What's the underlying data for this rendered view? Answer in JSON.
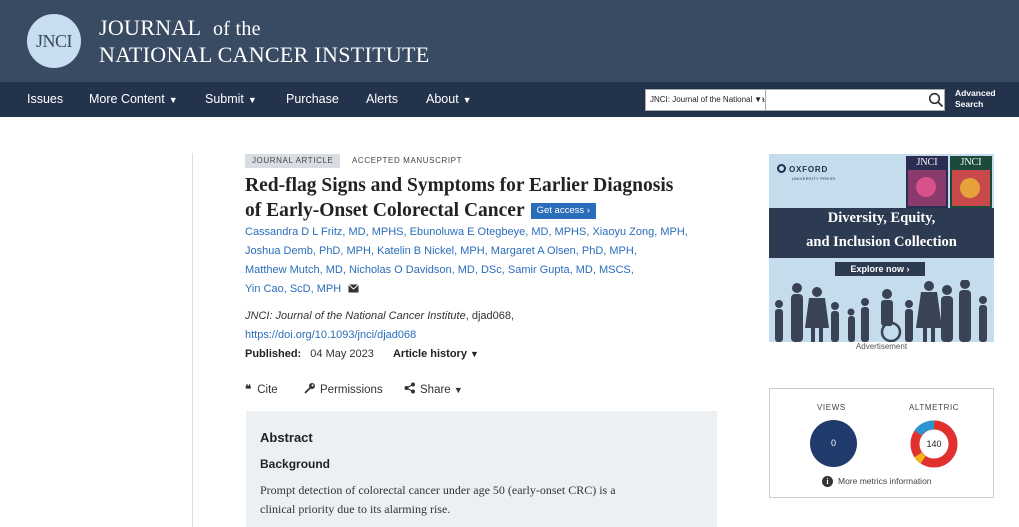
{
  "header": {
    "logo_text": "JNCI",
    "title_line1_a": "JOURNAL",
    "title_line1_b": "of the",
    "title_line2": "NATIONAL CANCER INSTITUTE"
  },
  "nav": {
    "items": [
      {
        "label": "Issues",
        "dropdown": false
      },
      {
        "label": "More Content",
        "dropdown": true
      },
      {
        "label": "Submit",
        "dropdown": true
      },
      {
        "label": "Purchase",
        "dropdown": false
      },
      {
        "label": "Alerts",
        "dropdown": false
      },
      {
        "label": "About",
        "dropdown": true
      }
    ],
    "search_scope": "JNCI: Journal of the National Cancer Institute",
    "search_placeholder": "",
    "advanced_search_line1": "Advanced",
    "advanced_search_line2": "Search"
  },
  "article": {
    "type_badge": "JOURNAL ARTICLE",
    "status_badge": "ACCEPTED MANUSCRIPT",
    "title_line1": "Red-flag Signs and Symptoms for Earlier Diagnosis",
    "title_line2": "of Early-Onset Colorectal Cancer",
    "get_access": "Get access",
    "authors": [
      "Cassandra D L Fritz, MD, MPHS",
      "Ebunoluwa E Otegbeye, MD, MPHS",
      "Xiaoyu Zong, MPH",
      "Joshua Demb, PhD, MPH",
      "Katelin B Nickel, MPH",
      "Margaret A Olsen, PhD, MPH",
      "Matthew Mutch, MD",
      "Nicholas O Davidson, MD, DSc",
      "Samir Gupta, MD, MSCS",
      "Yin Cao, ScD, MPH"
    ],
    "journal_name": "JNCI: Journal of the National Cancer Institute",
    "article_id": ", djad068,",
    "doi": "https://doi.org/10.1093/jnci/djad068",
    "published_label": "Published:",
    "published_date": "04 May 2023",
    "article_history": "Article history"
  },
  "tools": {
    "cite": "Cite",
    "permissions": "Permissions",
    "share": "Share"
  },
  "abstract": {
    "heading": "Abstract",
    "subheading": "Background",
    "text_line1": "Prompt detection of colorectal cancer under age 50 (early-onset CRC) is a",
    "text_line2": "clinical priority due to its alarming rise."
  },
  "ad": {
    "publisher": "OXFORD",
    "publisher_sub": "UNIVERSITY PRESS",
    "line1": "Diversity, Equity,",
    "line2": "and Inclusion Collection",
    "button": "Explore now",
    "label": "Advertisement",
    "cover1_logo": "JNCI",
    "cover2_logo": "JNCI"
  },
  "metrics": {
    "views_label": "VIEWS",
    "views_value": "0",
    "altmetric_label": "ALTMETRIC",
    "altmetric_value": "140",
    "more_info": "More metrics information"
  },
  "colors": {
    "masthead": "#394a63",
    "navbar": "#23334c",
    "link": "#2a6ebb",
    "views_circle": "#1f3a6b",
    "abstract_bg": "#edf0f3"
  }
}
